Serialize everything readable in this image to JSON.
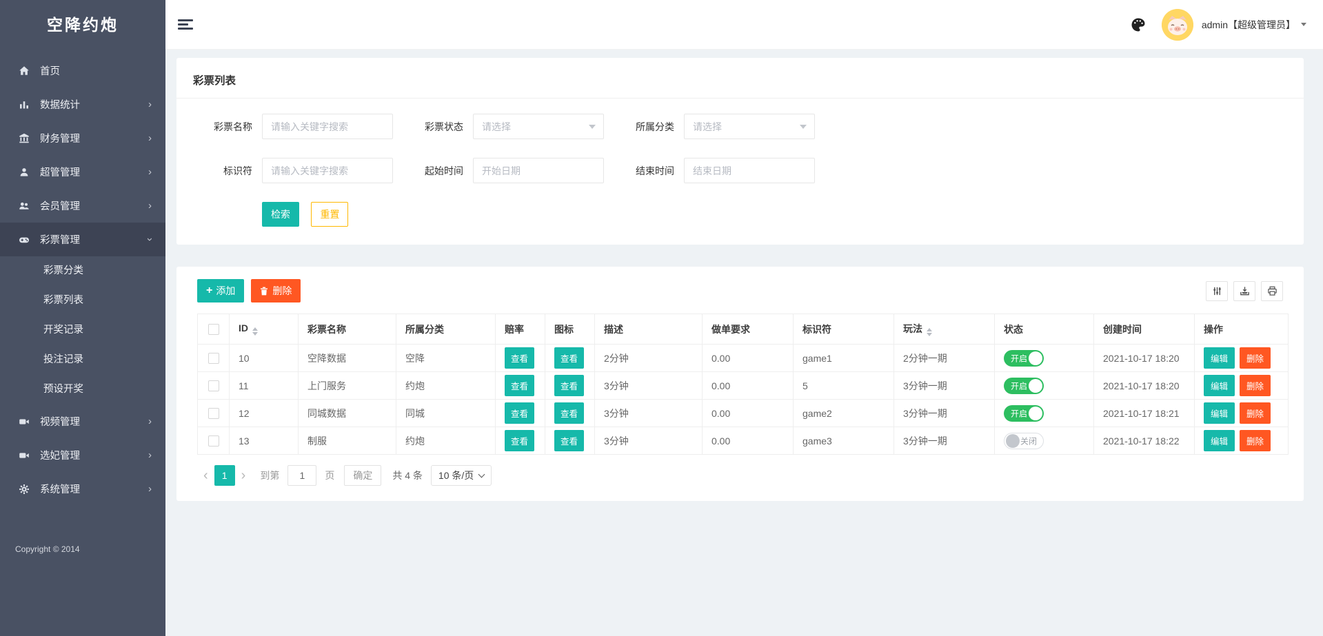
{
  "sidebar": {
    "logo": "空降约炮",
    "items": [
      {
        "label": "首页"
      },
      {
        "label": "数据统计"
      },
      {
        "label": "财务管理"
      },
      {
        "label": "超管管理"
      },
      {
        "label": "会员管理"
      },
      {
        "label": "彩票管理"
      },
      {
        "label": "视频管理"
      },
      {
        "label": "选妃管理"
      },
      {
        "label": "系统管理"
      }
    ],
    "submenu": [
      {
        "label": "彩票分类"
      },
      {
        "label": "彩票列表"
      },
      {
        "label": "开奖记录"
      },
      {
        "label": "投注记录"
      },
      {
        "label": "预设开奖"
      }
    ],
    "copyright": "Copyright © 2014"
  },
  "header": {
    "username": "admin【超级管理员】"
  },
  "filter": {
    "title": "彩票列表",
    "fields": {
      "name": {
        "label": "彩票名称",
        "placeholder": "请输入关键字搜索"
      },
      "status": {
        "label": "彩票状态",
        "placeholder": "请选择"
      },
      "category": {
        "label": "所属分类",
        "placeholder": "请选择"
      },
      "identifier": {
        "label": "标识符",
        "placeholder": "请输入关键字搜索"
      },
      "start_time": {
        "label": "起始时间",
        "placeholder": "开始日期"
      },
      "end_time": {
        "label": "结束时间",
        "placeholder": "结束日期"
      }
    },
    "buttons": {
      "search": "检索",
      "reset": "重置"
    }
  },
  "table": {
    "toolbar": {
      "add": "添加",
      "delete": "删除"
    },
    "columns": [
      "ID",
      "彩票名称",
      "所属分类",
      "赔率",
      "图标",
      "描述",
      "做单要求",
      "标识符",
      "玩法",
      "状态",
      "创建时间",
      "操作"
    ],
    "view_label": "查看",
    "edit_label": "编辑",
    "delete_label": "删除",
    "rows": [
      {
        "id": "10",
        "name": "空降数据",
        "category": "空降",
        "desc": "2分钟",
        "requirement": "0.00",
        "identifier": "game1",
        "play": "2分钟一期",
        "status": "on",
        "status_label": "开启",
        "created": "2021-10-17 18:20"
      },
      {
        "id": "11",
        "name": "上门服务",
        "category": "约炮",
        "desc": "3分钟",
        "requirement": "0.00",
        "identifier": "5",
        "play": "3分钟一期",
        "status": "on",
        "status_label": "开启",
        "created": "2021-10-17 18:20"
      },
      {
        "id": "12",
        "name": "同城数据",
        "category": "同城",
        "desc": "3分钟",
        "requirement": "0.00",
        "identifier": "game2",
        "play": "3分钟一期",
        "status": "on",
        "status_label": "开启",
        "created": "2021-10-17 18:21"
      },
      {
        "id": "13",
        "name": "制服",
        "category": "约炮",
        "desc": "3分钟",
        "requirement": "0.00",
        "identifier": "game3",
        "play": "3分钟一期",
        "status": "off",
        "status_label": "关闭",
        "created": "2021-10-17 18:22"
      }
    ]
  },
  "pagination": {
    "current": "1",
    "goto_prefix": "到第",
    "goto_value": "1",
    "goto_suffix": "页",
    "confirm": "确定",
    "total": "共 4 条",
    "page_size": "10 条/页"
  },
  "colors": {
    "accent": "#16b9aa",
    "danger": "#ff5722",
    "warning": "#ffb800",
    "switch_on": "#2dbe60",
    "sidebar": "#495163"
  }
}
